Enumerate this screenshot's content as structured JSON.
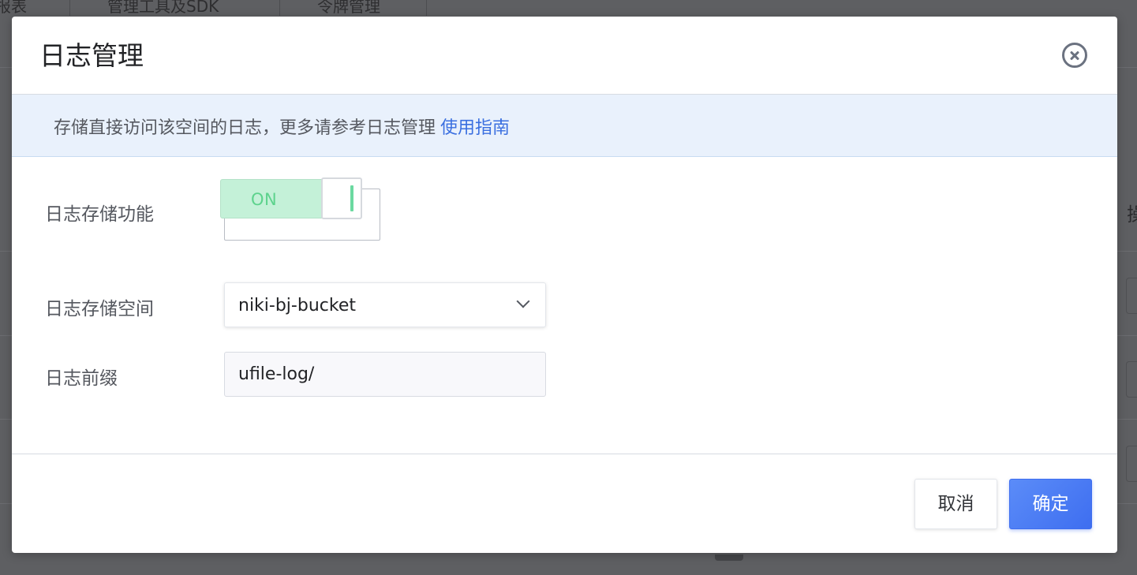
{
  "background": {
    "tabs": [
      "报表",
      "管理工具及SDK",
      "令牌管理"
    ],
    "side_char": "操"
  },
  "dialog": {
    "title": "日志管理",
    "close_icon": "close-circle-icon",
    "notice": {
      "text": "存储直接访问该空间的日志，更多请参考日志管理",
      "link": "使用指南"
    },
    "fields": {
      "log_storage": {
        "label": "日志存储功能",
        "toggle_label": "ON",
        "enabled": true
      },
      "log_bucket": {
        "label": "日志存储空间",
        "value": "niki-bj-bucket"
      },
      "log_prefix": {
        "label": "日志前缀",
        "value": "ufile-log/"
      }
    },
    "footer": {
      "cancel_label": "取消",
      "ok_label": "确定"
    }
  },
  "colors": {
    "accent": "#3e6ef0",
    "toggle_on_bg": "#c4f1d8",
    "toggle_on_text": "#5dd38d",
    "notice_bg": "#e9f1fc",
    "link": "#3a6fe0"
  }
}
